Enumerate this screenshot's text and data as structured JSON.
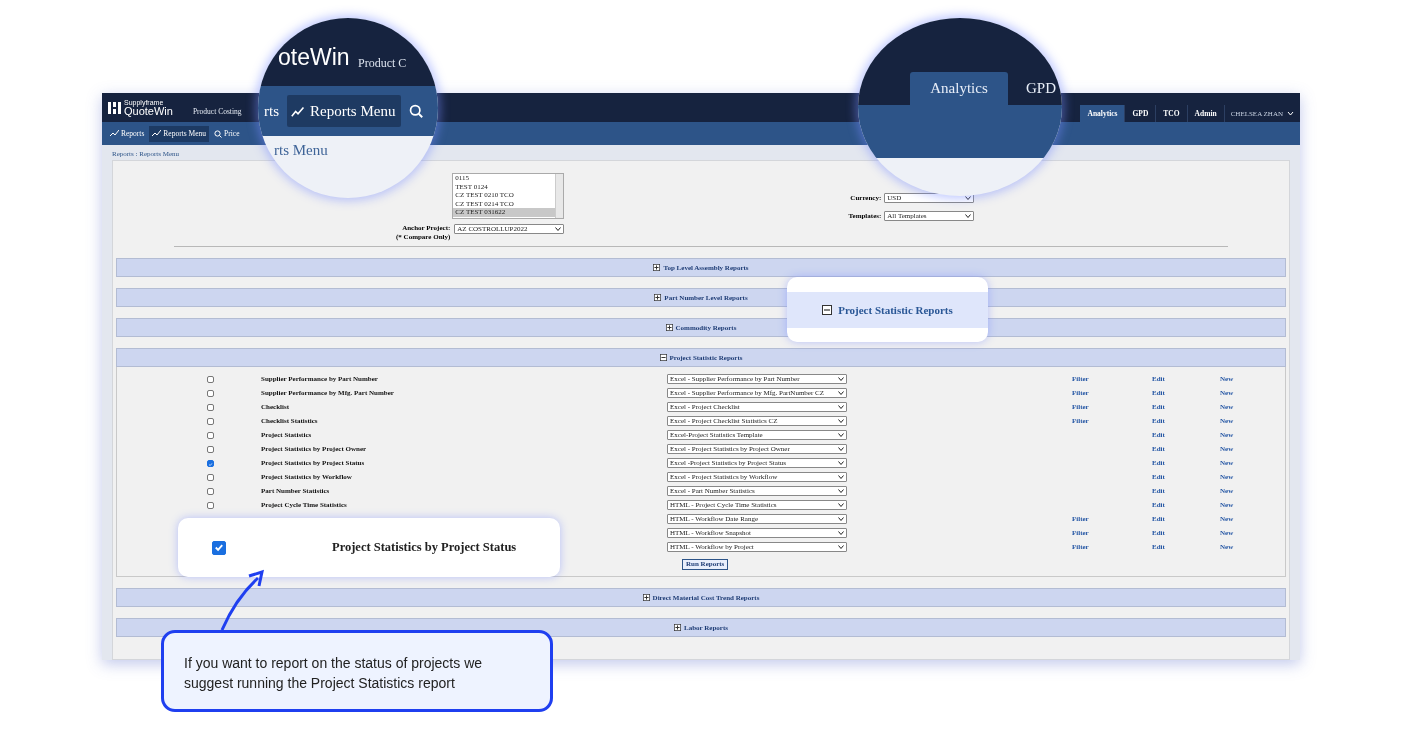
{
  "header": {
    "logo_tagline": "Supplyframe",
    "logo": "QuoteWin",
    "product": "Product Costing",
    "tabs": [
      {
        "label": "Analytics",
        "selected": true
      },
      {
        "label": "GPD",
        "selected": false
      },
      {
        "label": "TCO",
        "selected": false
      },
      {
        "label": "Admin",
        "selected": false
      }
    ],
    "user": "CHELSEA ZHAN"
  },
  "subnav": [
    {
      "label": "Reports",
      "selected": false
    },
    {
      "label": "Reports Menu",
      "selected": true
    },
    {
      "label": "Price",
      "selected": false
    }
  ],
  "breadcrumb": "Reports : Reports Menu",
  "form": {
    "projects": [
      {
        "label": "0115",
        "selected": false
      },
      {
        "label": "TEST 0124",
        "selected": false
      },
      {
        "label": "CZ TEST 0210 TCO",
        "selected": false
      },
      {
        "label": "CZ TEST 0214 TCO",
        "selected": false
      },
      {
        "label": "CZ TEST 031622",
        "selected": true
      }
    ],
    "anchor_label": "Anchor Project:",
    "anchor_note": "(* Compare Only)",
    "anchor_value": "AZ COSTROLLUP2022",
    "currency_label": "Currency:",
    "currency_value": "USD",
    "templates_label": "Templates:",
    "templates_value": "All Templates"
  },
  "sections": [
    {
      "title": "Top Level Assembly Reports",
      "expanded": false
    },
    {
      "title": "Part Number Level Reports",
      "expanded": false
    },
    {
      "title": "Commodity Reports",
      "expanded": false
    },
    {
      "title": "Project Statistic Reports",
      "expanded": true,
      "run_button": "Run Reports",
      "rows": [
        {
          "name": "Supplier Performance by Part Number",
          "checked": false,
          "template": "Excel - Supplier Performance by Part Number",
          "filter": "Filter",
          "edit": "Edit",
          "new": "New"
        },
        {
          "name": "Supplier Performance by Mfg. Part Number",
          "checked": false,
          "template": "Excel - Supplier Performance by Mfg. PartNumber CZ",
          "filter": "Filter",
          "edit": "Edit",
          "new": "New"
        },
        {
          "name": "Checklist",
          "checked": false,
          "template": "Excel - Project Checklist",
          "filter": "Filter",
          "edit": "Edit",
          "new": "New"
        },
        {
          "name": "Checklist Statistics",
          "checked": false,
          "template": "Excel - Project Checklist Statistics CZ",
          "filter": "Filter",
          "edit": "Edit",
          "new": "New"
        },
        {
          "name": "Project Statistics",
          "checked": false,
          "template": "Excel-Project Statistics Template",
          "edit": "Edit",
          "new": "New"
        },
        {
          "name": "Project Statistics by Project Owner",
          "checked": false,
          "template": "Excel - Project Statistics by Project Owner",
          "edit": "Edit",
          "new": "New"
        },
        {
          "name": "Project Statistics by Project Status",
          "checked": true,
          "template": "Excel -Project Statistics by Project Status",
          "edit": "Edit",
          "new": "New"
        },
        {
          "name": "Project Statistics by Workflow",
          "checked": false,
          "template": "Excel - Project Statistics by Workflow",
          "edit": "Edit",
          "new": "New"
        },
        {
          "name": "Part Number Statistics",
          "checked": false,
          "template": "Excel - Part Number Statistics",
          "edit": "Edit",
          "new": "New"
        },
        {
          "name": "Project Cycle Time Statistics",
          "checked": false,
          "template": "HTML - Project Cycle Time Statistics",
          "edit": "Edit",
          "new": "New"
        },
        {
          "template": "HTML - Workflow Date Range",
          "filter": "Filter",
          "edit": "Edit",
          "new": "New"
        },
        {
          "template": "HTML - Workflow Snapshot",
          "filter": "Filter",
          "edit": "Edit",
          "new": "New"
        },
        {
          "template": "HTML - Workflow by Project",
          "filter": "Filter",
          "edit": "Edit",
          "new": "New"
        }
      ]
    },
    {
      "title": "Direct Material Cost Trend Reports",
      "expanded": false
    },
    {
      "title": "Labor Reports",
      "expanded": false
    }
  ],
  "magnifier_left": {
    "logo": "oteWin",
    "product": "Product C",
    "tabs": [
      {
        "label": "rts",
        "selected": false
      },
      {
        "label": "Reports Menu",
        "selected": true
      }
    ],
    "heading": "rts Menu"
  },
  "magnifier_right": {
    "tabs": [
      {
        "label": "Analytics",
        "selected": true
      },
      {
        "label": "GPD",
        "selected": false
      }
    ]
  },
  "callout_section": {
    "title": "Project Statistic Reports",
    "expanded": true
  },
  "callout_row": {
    "name": "Project Statistics by Project Status",
    "checked": true
  },
  "tip": "If you want to report on the status of projects we suggest running the Project Statistics report"
}
